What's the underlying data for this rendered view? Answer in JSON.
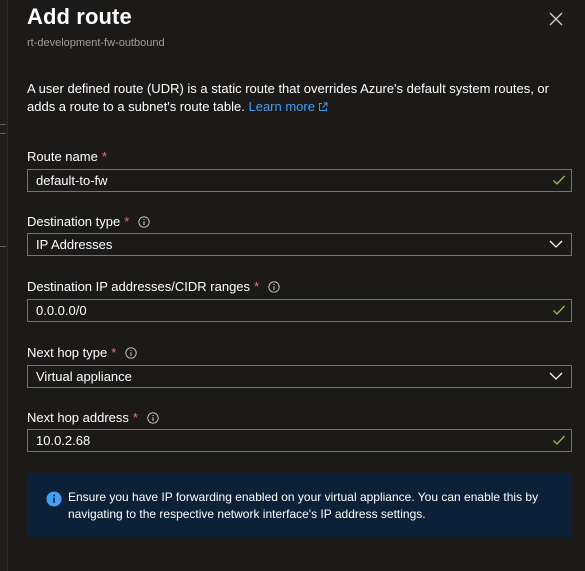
{
  "header": {
    "title": "Add route",
    "subtitle": "rt-development-fw-outbound",
    "close_icon": "close-icon"
  },
  "description": {
    "text": "A user defined route (UDR) is a static route that overrides Azure's default system routes, or adds a route to a subnet's route table.",
    "link_label": "Learn more",
    "link_icon": "external-link-icon"
  },
  "form": {
    "route_name": {
      "label": "Route name",
      "required_mark": "*",
      "value": "default-to-fw"
    },
    "destination_type": {
      "label": "Destination type",
      "required_mark": "*",
      "value": "IP Addresses"
    },
    "destination_ip": {
      "label": "Destination IP addresses/CIDR ranges",
      "required_mark": "*",
      "value": "0.0.0.0/0"
    },
    "next_hop_type": {
      "label": "Next hop type",
      "required_mark": "*",
      "value": "Virtual appliance"
    },
    "next_hop_address": {
      "label": "Next hop address",
      "required_mark": "*",
      "value": "10.0.2.68"
    }
  },
  "notice": {
    "icon": "info-icon",
    "text": "Ensure you have IP forwarding enabled on your virtual appliance. You can enable this by navigating to the respective network interface's IP address settings."
  },
  "colors": {
    "background": "#1b1a19",
    "field_border": "#b146c2",
    "required": "#f1707b",
    "link": "#479ef5",
    "valid_check": "#92c353",
    "notice_bg": "#0c2137",
    "notice_icon": "#479ef5"
  }
}
